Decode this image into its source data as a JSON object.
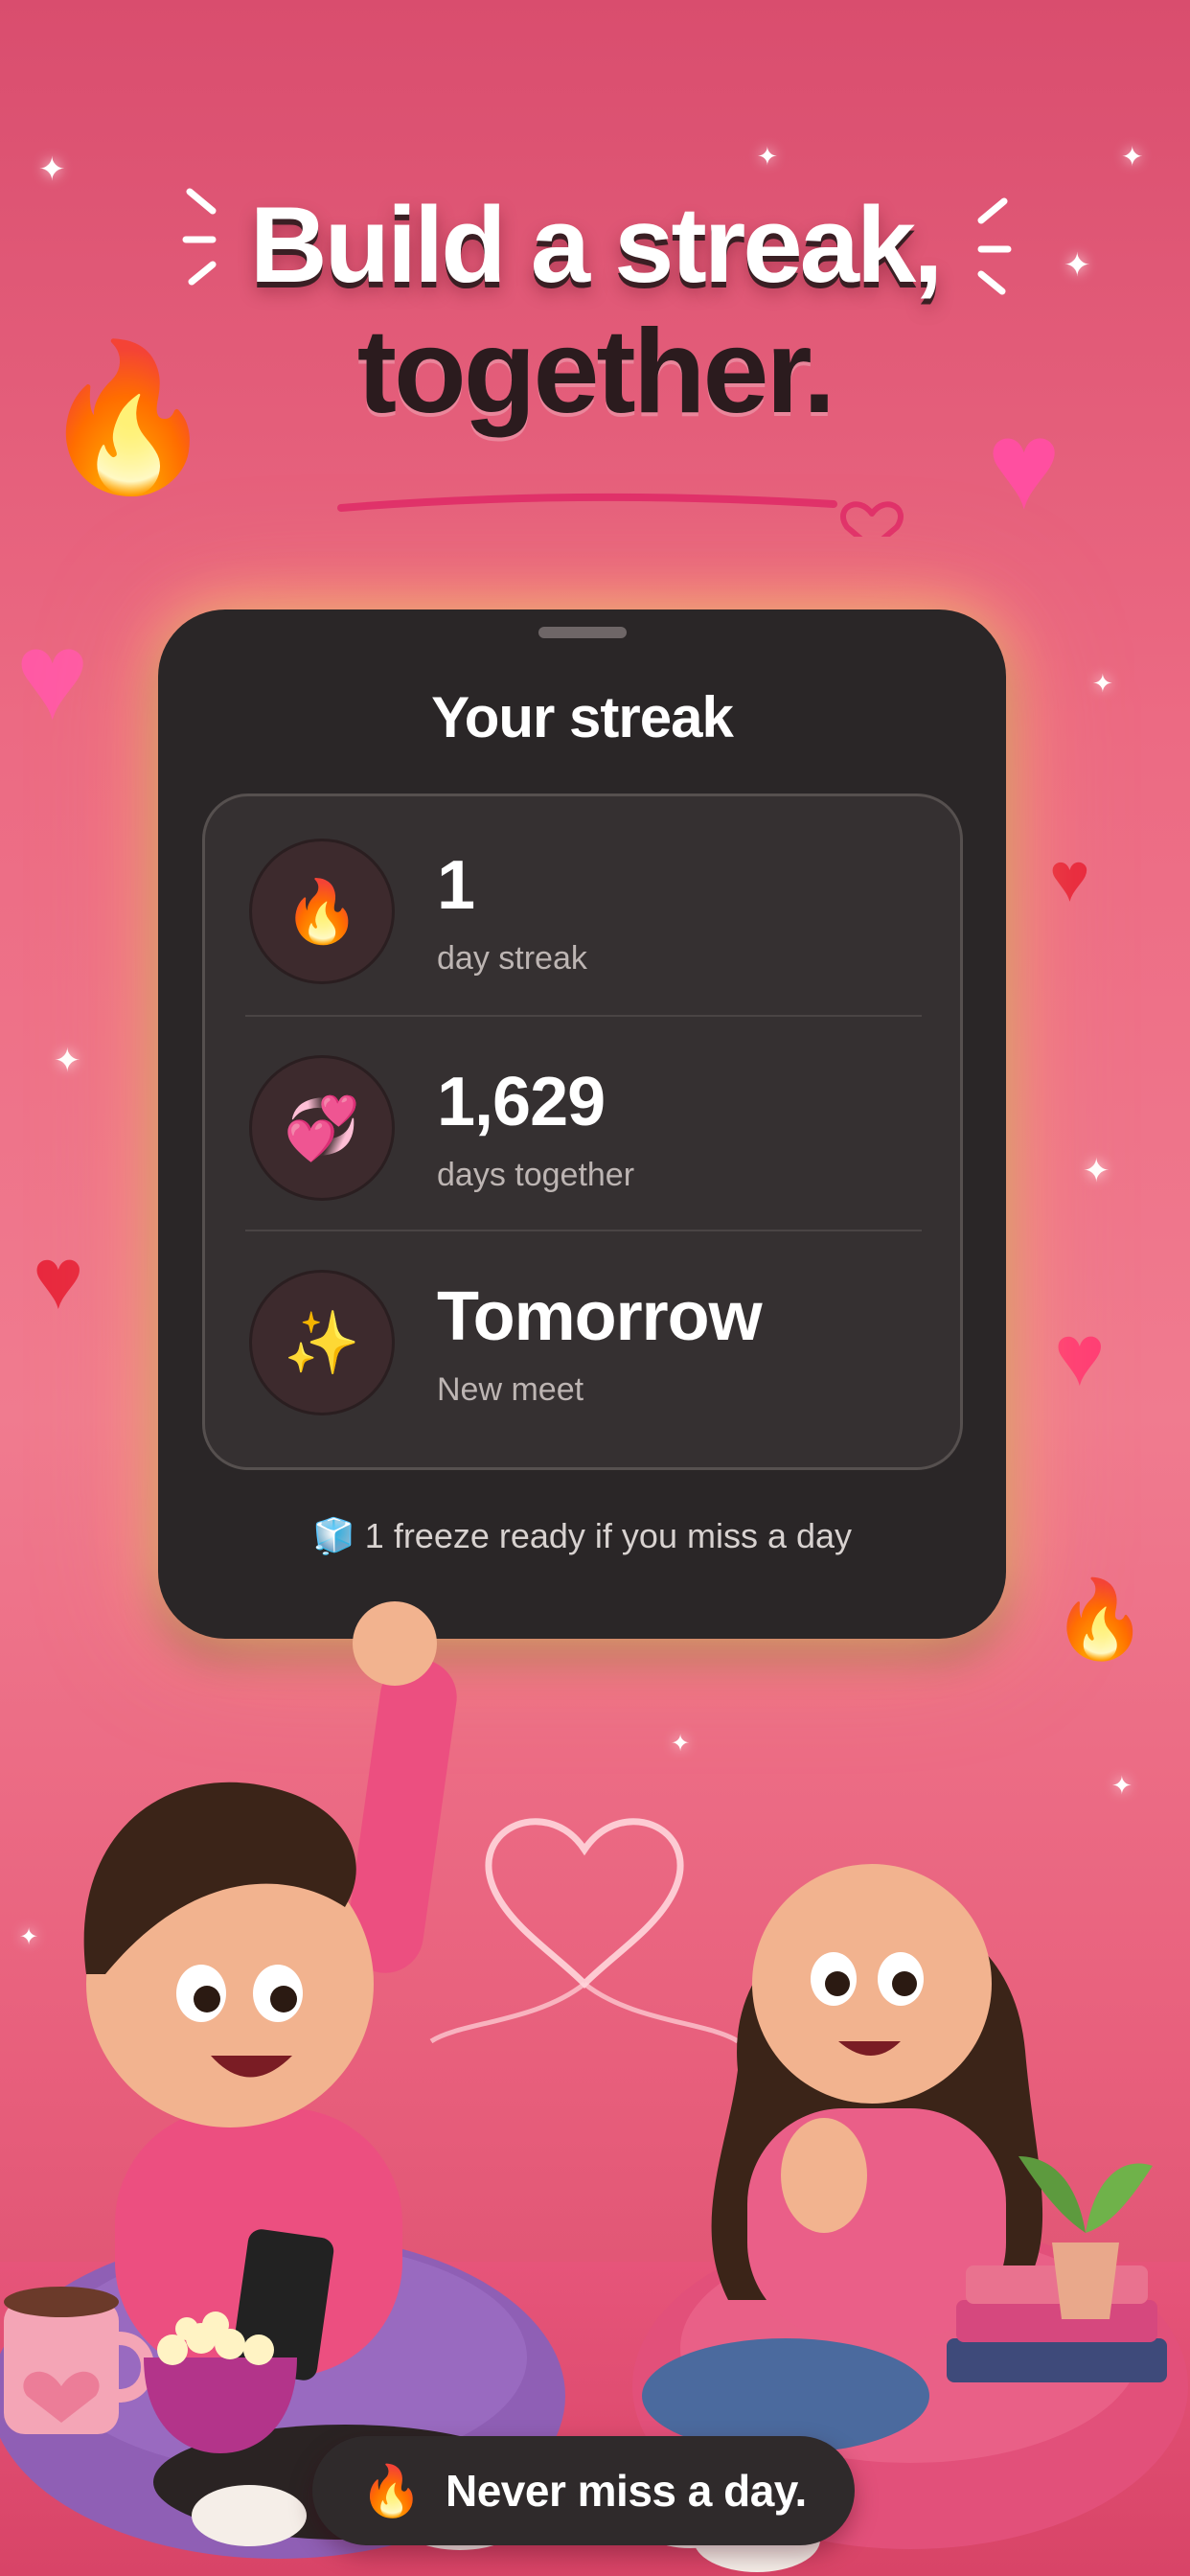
{
  "headline": {
    "line1": "Build a streak,",
    "line2": "together."
  },
  "card": {
    "title": "Your streak",
    "rows": [
      {
        "icon": "fire-icon",
        "glyph": "🔥",
        "value": "1",
        "caption": "day streak"
      },
      {
        "icon": "two-hearts-icon",
        "glyph": "💞",
        "value": "1,629",
        "caption": "days together"
      },
      {
        "icon": "sparkles-icon",
        "glyph": "✨",
        "value": "Tomorrow",
        "caption": "New meet"
      }
    ],
    "freeze": {
      "icon": "ice-cube-icon",
      "glyph": "🧊",
      "text": "1 freeze ready if you miss a day"
    }
  },
  "pill": {
    "icon": "fire-icon",
    "glyph": "🔥",
    "text": "Never miss a day."
  },
  "colors": {
    "background": "#ec6a83",
    "card": "#2a2627",
    "accent": "#e0306a"
  }
}
